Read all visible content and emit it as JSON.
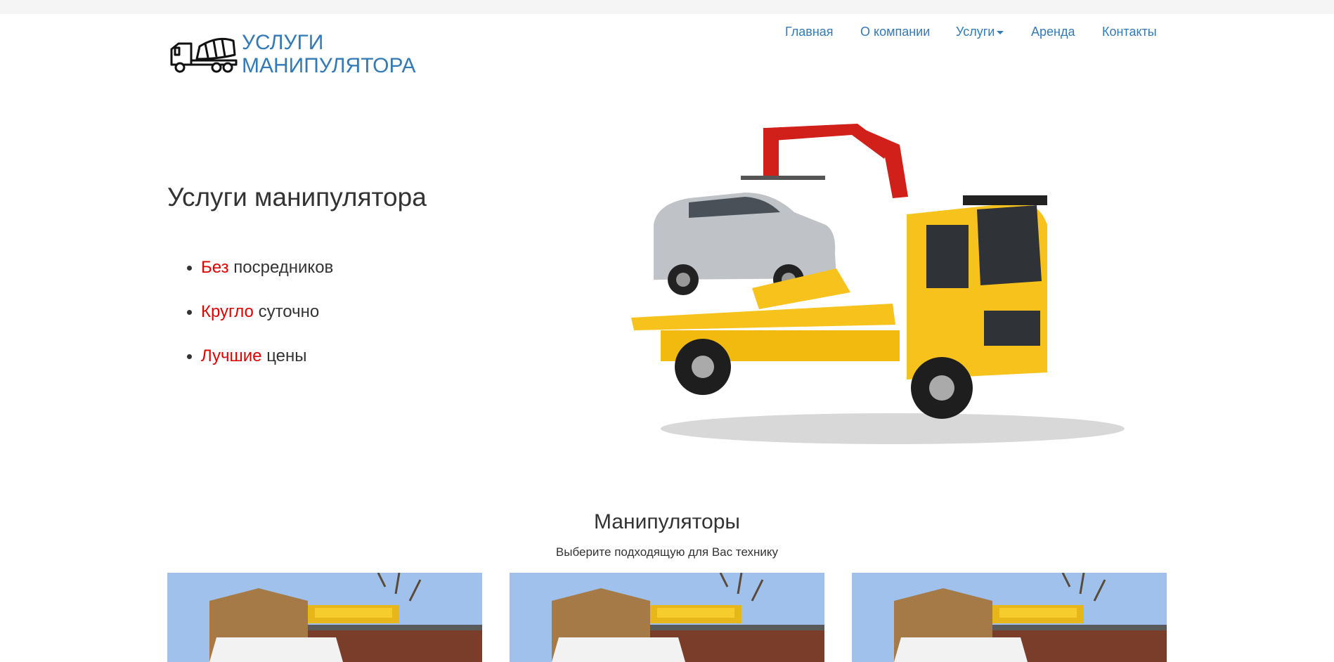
{
  "header": {
    "logo_line1": "Услуги",
    "logo_line2": "манипулятора",
    "logo_icon": "concrete-mixer-truck-icon"
  },
  "nav": {
    "items": [
      {
        "label": "Главная"
      },
      {
        "label": "О компании"
      },
      {
        "label": "Услуги",
        "has_dropdown": true
      },
      {
        "label": "Аренда"
      },
      {
        "label": "Контакты"
      }
    ]
  },
  "hero": {
    "title": "Услуги манипулятора",
    "bullets": [
      {
        "accent": "Без",
        "rest": " посредников"
      },
      {
        "accent": "Кругло",
        "rest": " суточно"
      },
      {
        "accent": "Лучшие",
        "rest": " цены"
      }
    ],
    "image_icon": "tow-truck-with-suv-image"
  },
  "section": {
    "title": "Манипуляторы",
    "subtitle": "Выберите подходящую для Вас технику",
    "cards": [
      {
        "image": "crane-truck-photo"
      },
      {
        "image": "crane-truck-photo"
      },
      {
        "image": "crane-truck-photo"
      }
    ]
  },
  "colors": {
    "link": "#337ab7",
    "accent_red": "#e00000",
    "text": "#333333",
    "truck_yellow": "#f7c21b",
    "crane_red": "#d11f1a"
  }
}
